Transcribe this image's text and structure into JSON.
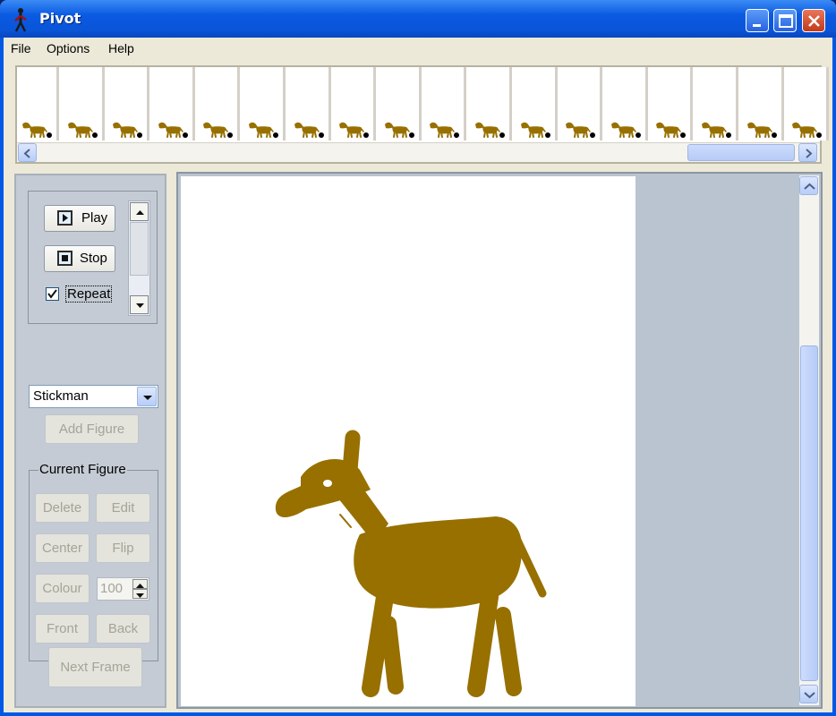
{
  "window": {
    "title": "Pivot"
  },
  "menu": {
    "items": [
      "File",
      "Options",
      "Help"
    ]
  },
  "timeline": {
    "frame_count": 18
  },
  "playback": {
    "play_label": "Play",
    "stop_label": "Stop",
    "repeat_label": "Repeat",
    "repeat_checked": true
  },
  "figure_select": {
    "selected": "Stickman"
  },
  "add_figure_label": "Add Figure",
  "current_figure": {
    "group_label": "Current Figure",
    "delete_label": "Delete",
    "edit_label": "Edit",
    "center_label": "Center",
    "flip_label": "Flip",
    "colour_label": "Colour",
    "size_value": "100",
    "front_label": "Front",
    "back_label": "Back"
  },
  "next_frame_label": "Next Frame",
  "colors": {
    "horse": "#977000",
    "canvas": "#ffffff",
    "titlebar": "#0a5ae2"
  }
}
